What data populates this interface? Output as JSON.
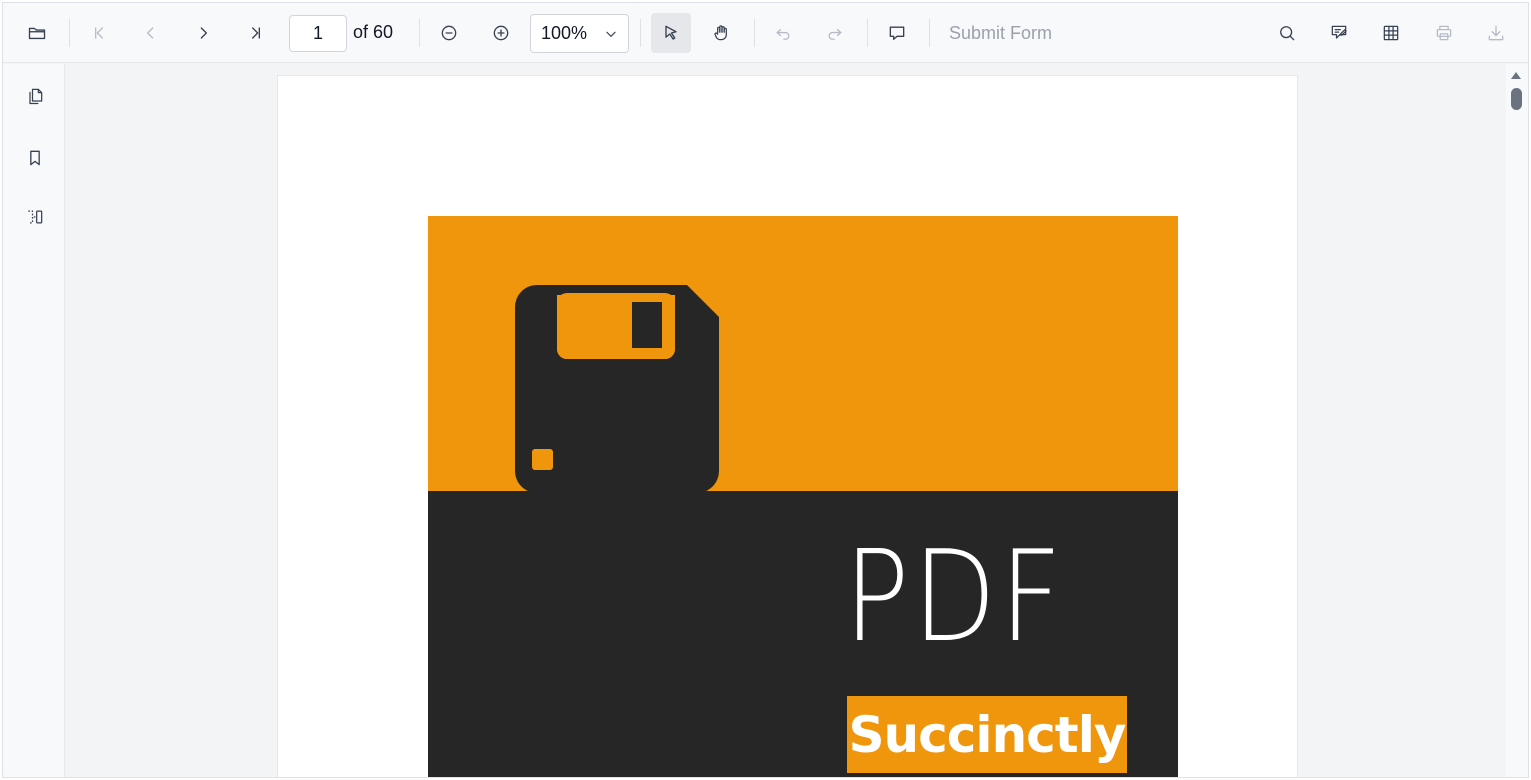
{
  "toolbar": {
    "open_icon": "folder-open-icon",
    "first_icon": "first-page-icon",
    "prev_icon": "previous-page-icon",
    "next_icon": "next-page-icon",
    "last_icon": "last-page-icon",
    "current_page": "1",
    "page_count_label": "of 60",
    "zoom_out_icon": "zoom-out-icon",
    "zoom_in_icon": "zoom-in-icon",
    "zoom_value": "100%",
    "selection_icon": "text-select-icon",
    "pan_icon": "pan-hand-icon",
    "undo_icon": "undo-icon",
    "redo_icon": "redo-icon",
    "comment_icon": "comment-icon",
    "submit_form_label": "Submit Form",
    "search_icon": "search-icon",
    "annotation_icon": "annotation-edit-icon",
    "form_designer_icon": "form-designer-icon",
    "print_icon": "print-icon",
    "download_icon": "download-icon"
  },
  "sidebar": {
    "items": [
      "page-thumbnails-icon",
      "bookmarks-icon",
      "organize-pages-icon"
    ]
  },
  "document": {
    "cover_title": "PDF",
    "cover_subtitle": "Succinctly"
  },
  "colors": {
    "cover_orange": "#ef960d",
    "cover_dark": "#262626"
  }
}
